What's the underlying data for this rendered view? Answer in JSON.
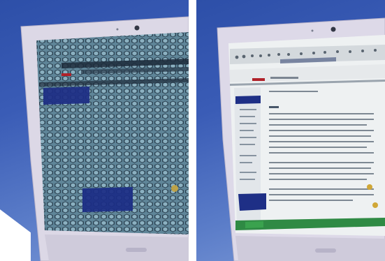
{
  "photos": [
    {
      "subject": "laptop-with-privacy-filter",
      "screen_pattern": "hexagonal-privacy-filter"
    },
    {
      "subject": "laptop-showing-web-page"
    }
  ],
  "colors": {
    "background_blue": "#3a5cb6",
    "bezel": "#d9d6e4",
    "screen_header_red": "#b0222a",
    "screen_nav_blue": "#1a2f8a"
  }
}
